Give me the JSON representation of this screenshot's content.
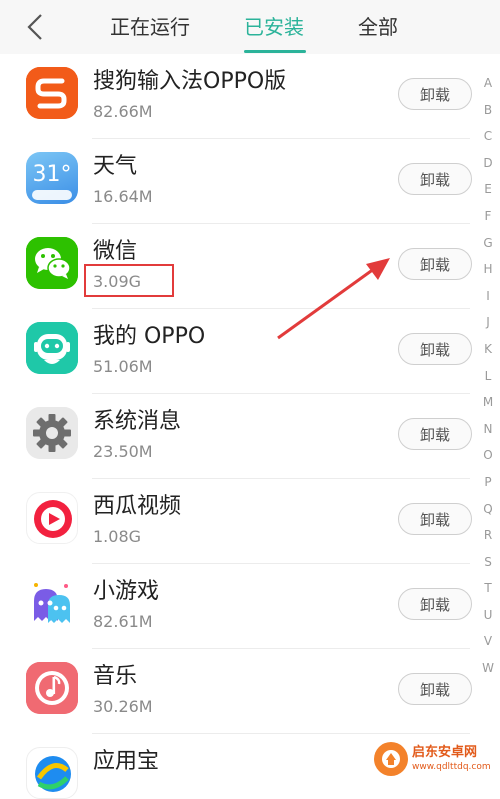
{
  "header": {
    "tabs": [
      {
        "label": "正在运行"
      },
      {
        "label": "已安装"
      },
      {
        "label": "全部"
      }
    ],
    "active_tab": "已安装",
    "accent_color": "#2bb39a"
  },
  "apps": [
    {
      "name": "搜狗输入法OPPO版",
      "size": "82.66M",
      "action": "卸载",
      "icon": "sogou-icon"
    },
    {
      "name": "天气",
      "size": "16.64M",
      "action": "卸载",
      "icon": "weather-icon",
      "icon_text": "31°"
    },
    {
      "name": "微信",
      "size": "3.09G",
      "action": "卸载",
      "icon": "wechat-icon"
    },
    {
      "name": "我的 OPPO",
      "size": "51.06M",
      "action": "卸载",
      "icon": "my-oppo-icon"
    },
    {
      "name": "系统消息",
      "size": "23.50M",
      "action": "卸载",
      "icon": "gear-icon"
    },
    {
      "name": "西瓜视频",
      "size": "1.08G",
      "action": "卸载",
      "icon": "xigua-video-icon"
    },
    {
      "name": "小游戏",
      "size": "82.61M",
      "action": "卸载",
      "icon": "mini-games-icon"
    },
    {
      "name": "音乐",
      "size": "30.26M",
      "action": "卸载",
      "icon": "music-icon"
    },
    {
      "name": "应用宝",
      "size": "",
      "action": "",
      "icon": "app-store-icon"
    }
  ],
  "alphabet_index": [
    "A",
    "B",
    "C",
    "D",
    "E",
    "F",
    "G",
    "H",
    "I",
    "J",
    "K",
    "L",
    "M",
    "N",
    "O",
    "P",
    "Q",
    "R",
    "S",
    "T",
    "U",
    "V",
    "W"
  ],
  "annotation": {
    "highlight_color": "#e23b3b"
  },
  "watermark": {
    "title": "启东安卓网",
    "url": "www.qdlttdq.com"
  }
}
